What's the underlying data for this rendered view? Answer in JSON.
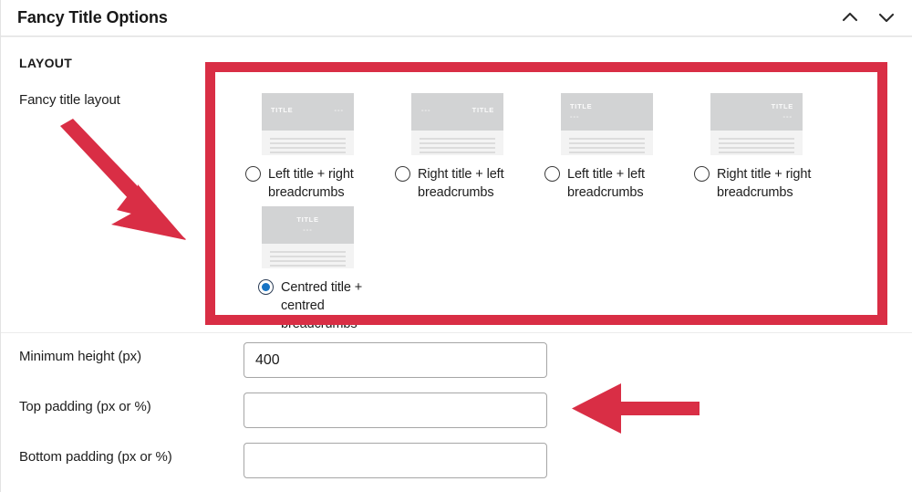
{
  "header": {
    "title": "Fancy Title Options",
    "icons": [
      {
        "name": "chevron-up-icon"
      },
      {
        "name": "chevron-down-icon"
      }
    ]
  },
  "section": {
    "label": "LAYOUT",
    "field_label": "Fancy title layout"
  },
  "layout_options": [
    {
      "id": "left-title-right-breadcrumbs",
      "label": "Left title + right breadcrumbs",
      "title_text": "TITLE",
      "breadcrumb_text": "---",
      "selected": false
    },
    {
      "id": "right-title-left-breadcrumbs",
      "label": "Right title + left breadcrumbs",
      "title_text": "TITLE",
      "breadcrumb_text": "---",
      "selected": false
    },
    {
      "id": "left-title-left-breadcrumbs",
      "label": "Left title + left breadcrumbs",
      "title_text": "TITLE",
      "breadcrumb_text": "---",
      "selected": false
    },
    {
      "id": "right-title-right-breadcrumbs",
      "label": "Right title + right breadcrumbs",
      "title_text": "TITLE",
      "breadcrumb_text": "---",
      "selected": false
    },
    {
      "id": "centred-title-centred-breadcrumbs",
      "label": "Centred title + centred breadcrumbs",
      "title_text": "TITLE",
      "breadcrumb_text": "---",
      "selected": true
    }
  ],
  "fields": [
    {
      "id": "minimum-height",
      "label": "Minimum height (px)",
      "value": "400",
      "placeholder": ""
    },
    {
      "id": "top-padding",
      "label": "Top padding (px or %)",
      "value": "",
      "placeholder": ""
    },
    {
      "id": "bottom-padding",
      "label": "Bottom padding (px or %)",
      "value": "",
      "placeholder": ""
    }
  ],
  "annotations": {
    "color": "#d92e45",
    "highlight_rectangle": "layout-options-area",
    "arrows": [
      {
        "name": "diagonal-arrow-to-layout-options",
        "direction": "down-right"
      },
      {
        "name": "left-arrow-to-top-padding-field",
        "direction": "left"
      }
    ]
  },
  "colors": {
    "annotation_red": "#d92e45",
    "radio_selected_blue": "#1673c4",
    "thumbnail_header_gray": "#d2d3d4",
    "thumbnail_body_gray": "#f3f3f3"
  }
}
